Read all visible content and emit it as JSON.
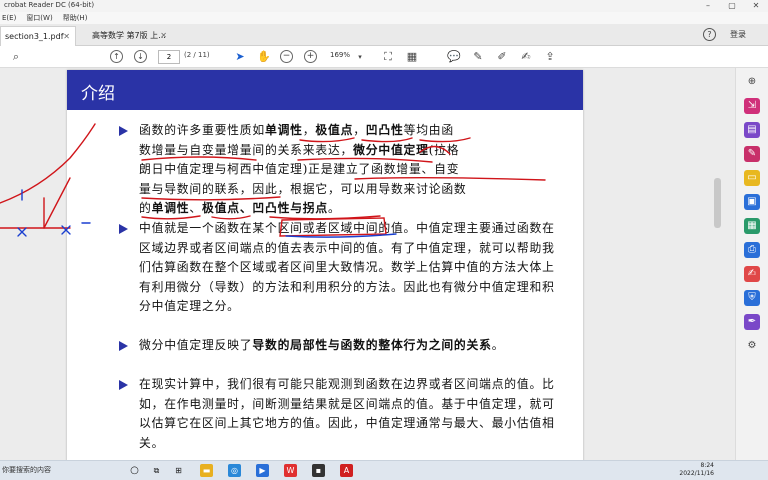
{
  "titlebar": {
    "title": "crobat Reader DC (64-bit)",
    "controls": [
      "–",
      "▢",
      "✕"
    ]
  },
  "menubar": {
    "items": [
      "E(E)",
      "窗口(W)",
      "帮助(H)"
    ]
  },
  "tabs": [
    {
      "label": "section3_1.pdf",
      "close": "✕"
    },
    {
      "label": "高等数学 第7版 上...",
      "close": "✕"
    }
  ],
  "header": {
    "help": "?",
    "login": "登录"
  },
  "toolbar": {
    "page_current": "2",
    "page_total": "(2 / 11)",
    "zoom": "169%",
    "icons": [
      "search-icon",
      "arrow-up-icon",
      "arrow-down-icon",
      "cursor-icon",
      "hand-icon",
      "zoom-out-icon",
      "zoom-in-icon",
      "zoom-dropdown-icon",
      "fit-page-icon",
      "comment-icon",
      "pen-icon",
      "highlight-icon",
      "sign-icon",
      "share-icon"
    ]
  },
  "document": {
    "heading": "介绍",
    "p1_lines": [
      [
        "函数的许多重要性质如",
        "单调性",
        "，",
        "极值点",
        "，",
        "凹凸性",
        "等均由函"
      ],
      [
        "数增量与自变量增量间的关系来表达，",
        "微分中值定理",
        "(拉格"
      ],
      [
        "朗日中值定理与柯西中值定理)正是建立了函数增量、自变"
      ],
      [
        "量与导数间的联系，因此，根据它，可以用导数来讨论函数"
      ],
      [
        "的",
        "单调性",
        "、",
        "极值点",
        "、凹凸性与拐点",
        "。"
      ]
    ],
    "p2": "中值就是一个函数在某个区间或者区域中间的值。中值定理主要通过函数在区域边界或者区间端点的值去表示中间的值。有了中值定理，就可以帮助我们估算函数在整个区域或者区间里大致情况。数学上估算中值的方法大体上有利用微分（导数）的方法和利用积分的方法。因此也有微分中值定理和积分中值定理之分。",
    "p3_pre": "微分中值定理反映了",
    "p3_bold": "导数的局部性与函数的整体行为之间的关系",
    "p3_post": "。",
    "p4": "在现实计算中，我们很有可能只能观测到函数在边界或者区间端点的值。比如，在作电测量时，间断测量结果就是区间端点的值。基于中值定理，就可以估算它在区间上其它地方的值。因此，中值定理通常与最大、最小估值相关。"
  },
  "taskbar": {
    "search_text": "在这里输入你要搜索的内容",
    "search_visible": "你要搜索的内容",
    "time": "8:24",
    "date": "2022/11/16"
  }
}
